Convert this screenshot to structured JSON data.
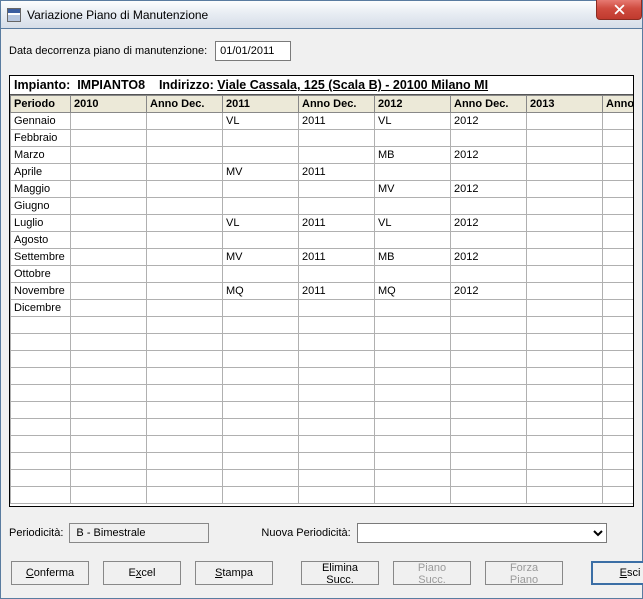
{
  "window": {
    "title": "Variazione Piano di Manutenzione"
  },
  "dateRow": {
    "label": "Data decorrenza piano di manutenzione:",
    "value": "01/01/2011"
  },
  "impianto": {
    "prefix": "Impianto:",
    "name": "IMPIANTO8",
    "addrPrefix": "Indirizzo:",
    "address": "Viale Cassala, 125 (Scala B) - 20100 Milano MI"
  },
  "columns": [
    "Periodo",
    "2010",
    "Anno Dec.",
    "2011",
    "Anno Dec.",
    "2012",
    "Anno Dec.",
    "2013",
    "Anno Dec."
  ],
  "rows": [
    {
      "p": "Gennaio",
      "c": [
        "",
        "",
        "VL",
        "2011",
        "VL",
        "2012",
        "",
        ""
      ],
      "hl": {
        "2": "g",
        "4": "y"
      }
    },
    {
      "p": "Febbraio",
      "c": [
        "",
        "",
        "",
        "",
        "",
        "",
        "",
        ""
      ]
    },
    {
      "p": "Marzo",
      "c": [
        "",
        "",
        "",
        "",
        "MB",
        "2012",
        "",
        ""
      ],
      "hl": {
        "4": "y"
      }
    },
    {
      "p": "Aprile",
      "c": [
        "",
        "",
        "MV",
        "2011",
        "",
        "",
        "",
        ""
      ],
      "hl": {
        "2": "g"
      }
    },
    {
      "p": "Maggio",
      "c": [
        "",
        "",
        "",
        "",
        "MV",
        "2012",
        "",
        ""
      ],
      "hl": {
        "4": "y"
      }
    },
    {
      "p": "Giugno",
      "c": [
        "",
        "",
        "",
        "",
        "",
        "",
        "",
        ""
      ]
    },
    {
      "p": "Luglio",
      "c": [
        "",
        "",
        "VL",
        "2011",
        "VL",
        "2012",
        "",
        ""
      ],
      "hl": {
        "2": "y",
        "4": "y"
      }
    },
    {
      "p": "Agosto",
      "c": [
        "",
        "",
        "",
        "",
        "",
        "",
        "",
        ""
      ]
    },
    {
      "p": "Settembre",
      "c": [
        "",
        "",
        "MV",
        "2011",
        "MB",
        "2012",
        "",
        ""
      ],
      "hl": {
        "2": "y",
        "4": "y"
      }
    },
    {
      "p": "Ottobre",
      "c": [
        "",
        "",
        "",
        "",
        "",
        "",
        "",
        ""
      ]
    },
    {
      "p": "Novembre",
      "c": [
        "",
        "",
        "MQ",
        "2011",
        "MQ",
        "2012",
        "",
        ""
      ],
      "hl": {
        "2": "y",
        "4": "y"
      }
    },
    {
      "p": "Dicembre",
      "c": [
        "",
        "",
        "",
        "",
        "",
        "",
        "",
        ""
      ]
    }
  ],
  "periodicity": {
    "label": "Periodicità:",
    "value": "B - Bimestrale",
    "newLabel": "Nuova Periodicità:",
    "newValue": ""
  },
  "buttons": {
    "conferma": "Conferma",
    "excel": "Excel",
    "stampa": "Stampa",
    "eliminaSucc": "Elimina Succ.",
    "pianoSucc": "Piano Succ.",
    "forzaPiano": "Forza Piano",
    "esci": "Esci"
  }
}
